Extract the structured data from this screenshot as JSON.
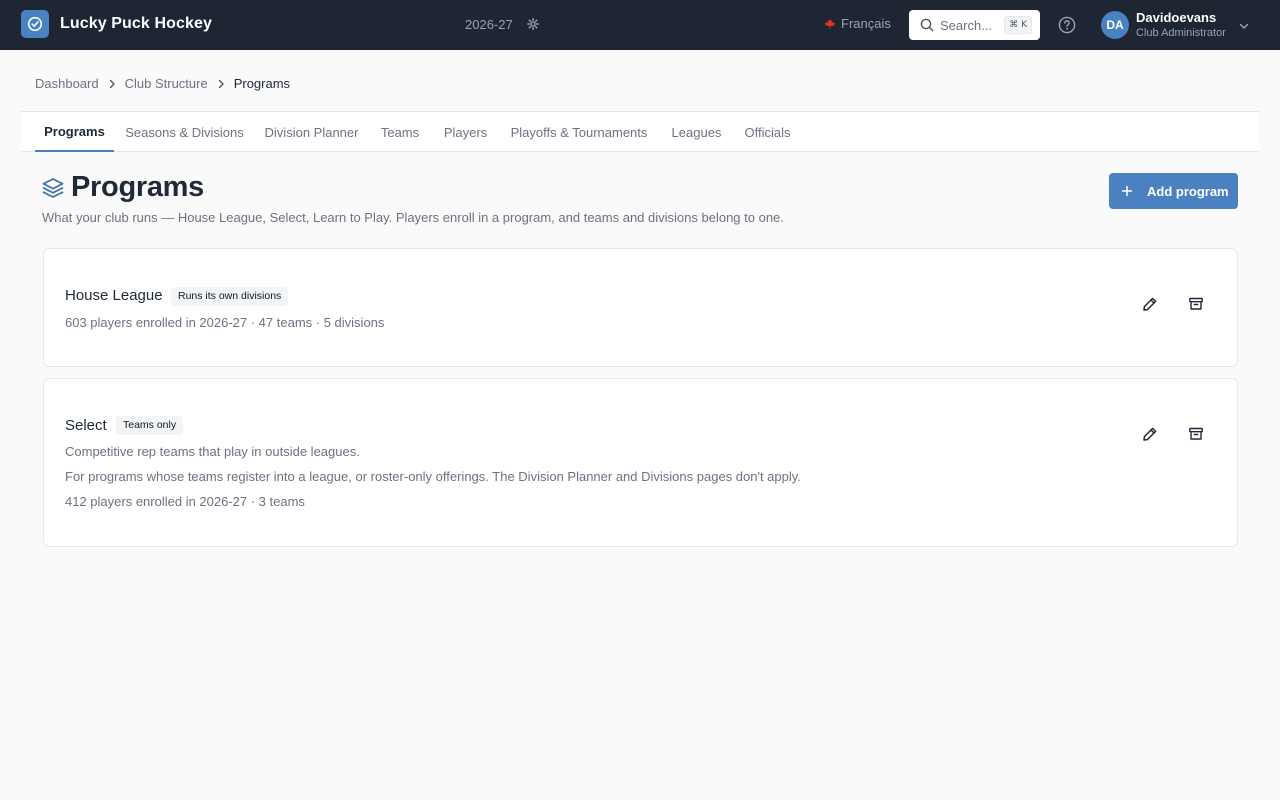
{
  "header": {
    "app_title": "Lucky Puck Hockey",
    "season": "2026-27",
    "language": "Français",
    "search_placeholder": "Search...",
    "search_shortcut": "⌘ K",
    "user_initials": "DA",
    "user_name": "Davidoevans",
    "user_role": "Club Administrator",
    "brand_color": "#4a82c1",
    "bar_color": "#1e2533"
  },
  "breadcrumb": {
    "items": [
      "Dashboard",
      "Club Structure"
    ],
    "current": "Programs"
  },
  "tabs": [
    {
      "label": "Programs",
      "active": true
    },
    {
      "label": "Seasons & Divisions",
      "active": false
    },
    {
      "label": "Division Planner",
      "active": false
    },
    {
      "label": "Teams",
      "active": false
    },
    {
      "label": "Players",
      "active": false
    },
    {
      "label": "Playoffs & Tournaments",
      "active": false
    },
    {
      "label": "Leagues",
      "active": false
    },
    {
      "label": "Officials",
      "active": false
    }
  ],
  "page": {
    "title": "Programs",
    "subtitle": "What your club runs — House League, Select, Learn to Play. Players enroll in a program, and teams and divisions belong to one.",
    "add_button": "Add program"
  },
  "programs": [
    {
      "name": "House League",
      "badge": "Runs its own divisions",
      "lines": [
        "603 players enrolled in 2026-27 · 47 teams · 5 divisions"
      ]
    },
    {
      "name": "Select",
      "badge": "Teams only",
      "lines": [
        "Competitive rep teams that play in outside leagues.",
        "For programs whose teams register into a league, or roster-only offerings. The Division Planner and Divisions pages don't apply.",
        "412 players enrolled in 2026-27 · 3 teams"
      ]
    }
  ]
}
